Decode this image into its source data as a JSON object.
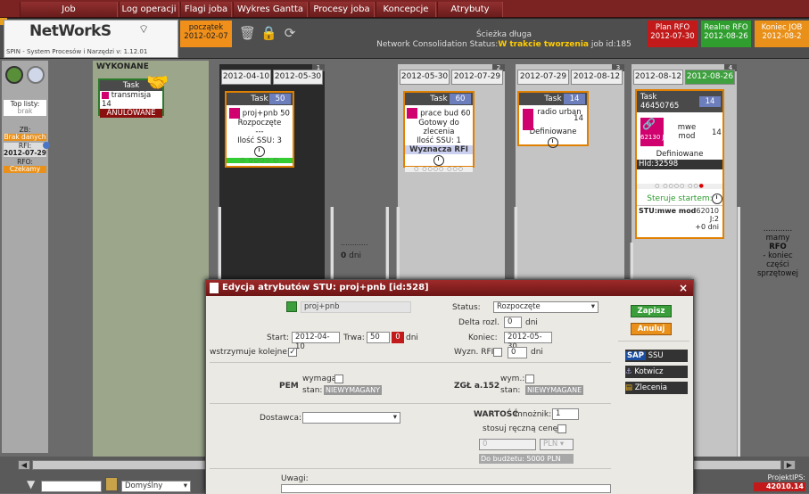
{
  "menu": {
    "items": [
      "Job",
      "Log operacji",
      "Flagi joba",
      "Wykres Gantta",
      "Procesy joba",
      "Koncepcje",
      "Atrybuty"
    ]
  },
  "header": {
    "logo": "NetWorkS",
    "logo_sub": "SPIN - System Procesów i Narzędzi   v: 1.12.01",
    "start_label": "początek",
    "start_date": "2012-02-07",
    "center_line1": "Ścieżka długa",
    "center_prefix": "Network Consolidation  Status:",
    "center_status": "W trakcie tworzenia",
    "center_job": " job id:185",
    "plan_label": "Plan RFO",
    "plan_date": "2012-07-30",
    "real_label": "Realne RFO",
    "real_date": "2012-08-26",
    "end_label": "Koniec JOB",
    "end_date": "2012-08-2"
  },
  "left_panel": {
    "top_label": "Top listy:",
    "top_value": "brak",
    "zb_label": "ZB:",
    "zb_value": "Brak danych",
    "rfi_label": "RFI:",
    "rfi_value": "2012-07-29",
    "rfo_label": "RFO:",
    "rfo_value": "Czekamy"
  },
  "done_column": {
    "title": "WYKONANE",
    "task_label": "Task",
    "task_name": "transmisja",
    "task_num": "14",
    "task_status": "ANULOWANE"
  },
  "columns": [
    {
      "num": "1",
      "start": "2012-04-10",
      "end": "2012-05-30",
      "task_label": "Task",
      "task_badge": "50",
      "name": "proj+pnb",
      "name_num": "50",
      "status": "Rozpoczęte",
      "line3": "---",
      "line4": "Ilość SSU: 3"
    },
    {
      "num": "2",
      "start": "2012-05-30",
      "end": "2012-07-29",
      "task_label": "Task",
      "task_badge": "60",
      "name": "prace bud",
      "name_num": "60",
      "status": "Gotowy do zlecenia",
      "line3": "Ilość SSU: 1",
      "line4": "Wyznacza RFI"
    },
    {
      "num": "3",
      "start": "2012-07-29",
      "end": "2012-08-12",
      "task_label": "Task",
      "task_badge": "14",
      "name": "radio urban",
      "name_num": "14",
      "status": "Definiowane",
      "line3": "",
      "line4": ""
    },
    {
      "num": "4",
      "start": "2012-08-12",
      "end": "2012-08-26",
      "task_label": "Task 46450765",
      "task_badge": "14",
      "name": "mwe mod",
      "name_num": "14",
      "code": "62130 J:2",
      "status": "Definiowane",
      "hid": "HId:32598",
      "steer": "Steruje startem:",
      "stu_label": "STU:mwe mod",
      "stu_code": "62010",
      "stu_j": "J:2",
      "stu_days": "+0 dni"
    }
  ],
  "gap": {
    "days_num": "0",
    "days_label": "dni",
    "dots": "............"
  },
  "right_note": {
    "dots": "............",
    "line1": "mamy",
    "line2": "RFO",
    "line3": "- koniec",
    "line4": "części",
    "line5": "sprzętowej"
  },
  "dialog": {
    "title": "Edycja atrybutów STU: proj+pnb [id:528]",
    "close": "×",
    "name_value": "proj+pnb",
    "status_label": "Status:",
    "status_value": "Rozpoczęte",
    "delta_label": "Delta rozl.",
    "delta_value": "0",
    "delta_unit": "dni",
    "start_label": "Start:",
    "start_value": "2012-04-10",
    "trwa_label": "Trwa:",
    "trwa_value": "50",
    "trwa_red": "0",
    "trwa_unit": "dni",
    "koniec_label": "Koniec:",
    "koniec_value": "2012-05-30",
    "wstrz_label": "wstrzymuje kolejne:",
    "wyzn_label": "Wyzn. RFI:",
    "wyzn_value": "0",
    "wyzn_unit": "dni",
    "pem_label": "PEM",
    "pem_wym": "wymaga:",
    "pem_stan": "stan:",
    "pem_stan_value": "NIEWYMAGANY",
    "zgl_label": "ZGŁ a.152",
    "zgl_wym": "wym.:",
    "zgl_stan": "stan:",
    "zgl_stan_value": "NIEWYMAGANE",
    "dostawca_label": "Dostawca:",
    "wartosc_label": "WARTOŚĆ",
    "mnoznik_label": "mnożnik:",
    "mnoznik_value": "1",
    "reczna_label": "stosuj ręczną cenę:",
    "price_value": "0",
    "currency": "PLN",
    "budget": "Do budżetu: 5000 PLN",
    "uwagi_label": "Uwagi:",
    "save": "Zapisz",
    "cancel": "Anuluj",
    "ssu": "SSU",
    "sap": "SAP",
    "kotwicz": "Kotwicz",
    "zlecenia": "Zlecenia"
  },
  "bottom": {
    "filter_value": "",
    "profile_value": "Domyślny",
    "projekt_label": "ProjektIPS:",
    "projekt_value": "42010.14"
  },
  "colors": {
    "accent_red": "#7b2323",
    "task_border": "#e08000",
    "status_yellow": "#ffcc00",
    "plan_red": "#c21a1a",
    "real_green": "#2f9e2f",
    "end_orange": "#e8901a"
  }
}
